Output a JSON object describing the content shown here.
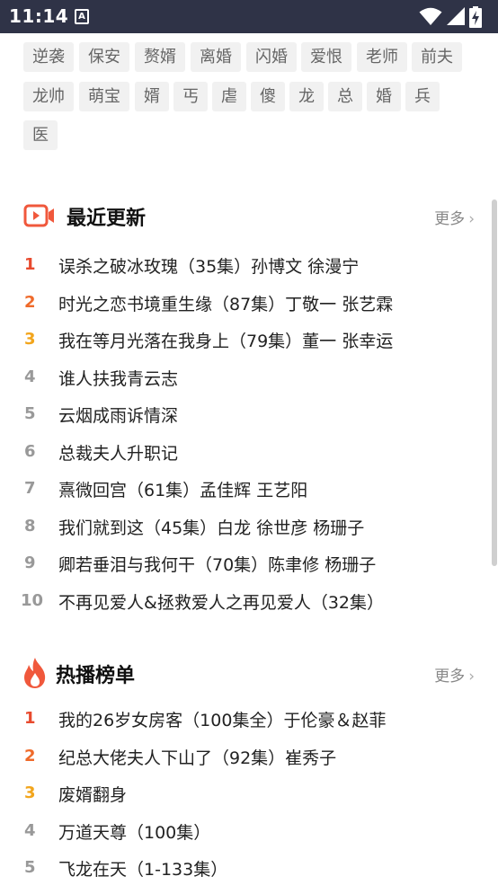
{
  "status_bar": {
    "time": "11:14",
    "notification_glyph": "A",
    "icons": [
      "wifi-icon",
      "signal-icon",
      "battery-charging-icon"
    ]
  },
  "tags": [
    "逆袭",
    "保安",
    "赘婿",
    "离婚",
    "闪婚",
    "爱恨",
    "老师",
    "前夫",
    "龙帅",
    "萌宝",
    "婿",
    "丐",
    "虐",
    "傻",
    "龙",
    "总",
    "婚",
    "兵",
    "医"
  ],
  "recent": {
    "title": "最近更新",
    "more": "更多",
    "items": [
      {
        "rank": "1",
        "title": "误杀之破冰玫瑰（35集）孙博文 徐漫宁"
      },
      {
        "rank": "2",
        "title": "时光之恋书境重生缘（87集）丁敬一 张艺霖"
      },
      {
        "rank": "3",
        "title": "我在等月光落在我身上（79集）董一 张幸运"
      },
      {
        "rank": "4",
        "title": "谁人扶我青云志"
      },
      {
        "rank": "5",
        "title": "云烟成雨诉情深"
      },
      {
        "rank": "6",
        "title": "总裁夫人升职记"
      },
      {
        "rank": "7",
        "title": "熹微回宫（61集）孟佳辉 王艺阳"
      },
      {
        "rank": "8",
        "title": "我们就到这（45集）白龙 徐世彦 杨珊子"
      },
      {
        "rank": "9",
        "title": "卿若垂泪与我何干（70集）陈聿修 杨珊子"
      },
      {
        "rank": "10",
        "title": "不再见爱人&拯救爱人之再见爱人（32集）"
      }
    ]
  },
  "hot": {
    "title": "热播榜单",
    "more": "更多",
    "items": [
      {
        "rank": "1",
        "title": "我的26岁女房客（100集全）于伦豪＆赵菲"
      },
      {
        "rank": "2",
        "title": "纪总大佬夫人下山了（92集）崔秀子"
      },
      {
        "rank": "3",
        "title": "废婿翻身"
      },
      {
        "rank": "4",
        "title": "万道天尊（100集）"
      },
      {
        "rank": "5",
        "title": "飞龙在天（1-133集）"
      }
    ]
  },
  "colors": {
    "status_bar_bg": "#2f3347",
    "rank1": "#e84a2e",
    "rank2": "#ef6a2a",
    "rank3": "#f2a51c",
    "rank_other": "#999999",
    "accent_icon": "#f0583c"
  }
}
